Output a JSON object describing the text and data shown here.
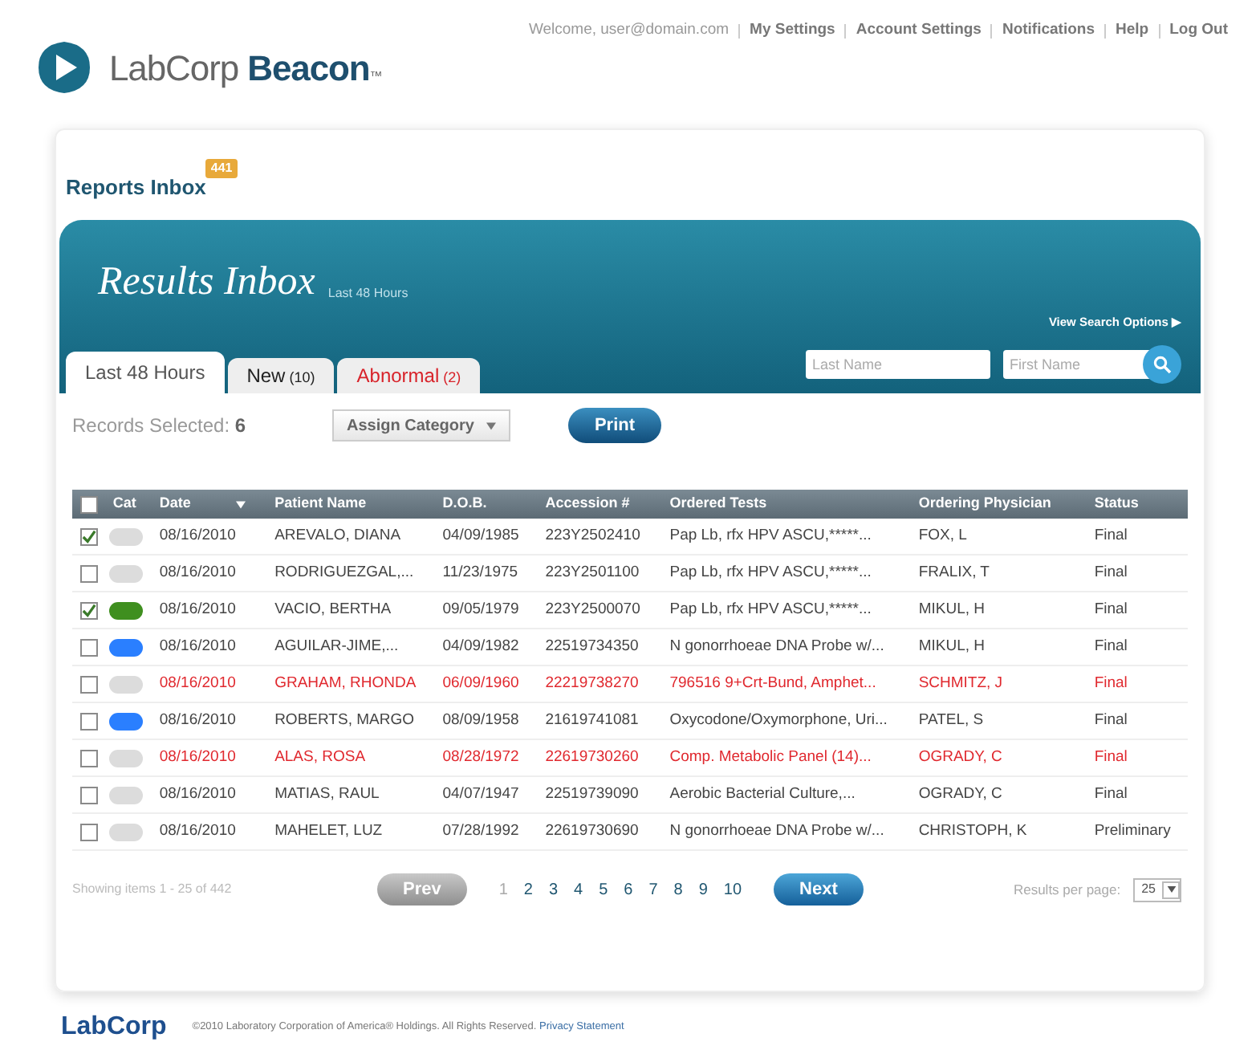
{
  "header": {
    "logo_text": "LabCorp",
    "logo_bold": "Beacon",
    "logo_mark": "™",
    "welcome": "Welcome, user@domain.com",
    "nav": [
      "My Settings",
      "Account Settings",
      "Notifications",
      "Help",
      "Log Out"
    ]
  },
  "reports_inbox": {
    "title": "Reports Inbox",
    "badge": "441"
  },
  "banner": {
    "title": "Results Inbox",
    "subtitle": "Last 48 Hours",
    "search_options": "View Search Options ▶"
  },
  "tabs": [
    {
      "label": "Last 48 Hours",
      "kind": "plain",
      "selected": true
    },
    {
      "label": "New",
      "count": "(10)",
      "kind": "plain",
      "selected": false
    },
    {
      "label": "Abnormal",
      "count": "(2)",
      "kind": "alert",
      "selected": false
    }
  ],
  "search": {
    "last_name": {
      "placeholder": "Last Name"
    },
    "first_name": {
      "placeholder": "First Name"
    }
  },
  "toolbar": {
    "records_label": "Records Selected:",
    "records_count": "6",
    "assign": "Assign Category",
    "print": "Print"
  },
  "table": {
    "select_all_checked": false,
    "category_header": "Cat",
    "columns": [
      "Date",
      "Patient Name",
      "D.O.B.",
      "Accession #",
      "Ordered Tests",
      "Ordering Physician",
      "Status"
    ],
    "rows": [
      {
        "checked": true,
        "color": "#dcdcdc",
        "abnormal": false,
        "cells": [
          "08/16/2010",
          "AREVALO, DIANA",
          "04/09/1985",
          "223Y2502410",
          "Pap Lb, rfx HPV ASCU,*****...",
          "FOX, L",
          "Final"
        ]
      },
      {
        "checked": false,
        "color": "#dcdcdc",
        "abnormal": false,
        "cells": [
          "08/16/2010",
          "RODRIGUEZGAL,...",
          "11/23/1975",
          "223Y2501100",
          "Pap Lb, rfx HPV ASCU,*****...",
          "FRALIX, T",
          "Final"
        ]
      },
      {
        "checked": true,
        "color": "#3f8f1f",
        "abnormal": false,
        "cells": [
          "08/16/2010",
          "VACIO, BERTHA",
          "09/05/1979",
          "223Y2500070",
          "Pap Lb, rfx HPV ASCU,*****...",
          "MIKUL, H",
          "Final"
        ]
      },
      {
        "checked": false,
        "color": "#2a7fff",
        "abnormal": false,
        "cells": [
          "08/16/2010",
          "AGUILAR-JIME,...",
          "04/09/1982",
          "22519734350",
          "N gonorrhoeae DNA Probe w/...",
          "MIKUL, H",
          "Final"
        ]
      },
      {
        "checked": false,
        "color": "#dcdcdc",
        "abnormal": true,
        "cells": [
          "08/16/2010",
          "GRAHAM, RHONDA",
          "06/09/1960",
          "22219738270",
          "796516 9+Crt-Bund, Amphet...",
          "SCHMITZ, J",
          "Final"
        ]
      },
      {
        "checked": false,
        "color": "#2a7fff",
        "abnormal": false,
        "cells": [
          "08/16/2010",
          "ROBERTS, MARGO",
          "08/09/1958",
          "21619741081",
          "Oxycodone/Oxymorphone, Uri...",
          "PATEL, S",
          "Final"
        ]
      },
      {
        "checked": false,
        "color": "#dcdcdc",
        "abnormal": true,
        "cells": [
          "08/16/2010",
          "ALAS, ROSA",
          "08/28/1972",
          "22619730260",
          "Comp. Metabolic Panel (14)...",
          "OGRADY, C",
          "Final"
        ]
      },
      {
        "checked": false,
        "color": "#dcdcdc",
        "abnormal": false,
        "cells": [
          "08/16/2010",
          "MATIAS, RAUL",
          "04/07/1947",
          "22519739090",
          "Aerobic Bacterial Culture,...",
          "OGRADY, C",
          "Final"
        ]
      },
      {
        "checked": false,
        "color": "#dcdcdc",
        "abnormal": false,
        "cells": [
          "08/16/2010",
          "MAHELET, LUZ",
          "07/28/1992",
          "22619730690",
          "N gonorrhoeae DNA Probe w/...",
          "CHRISTOPH, K",
          "Preliminary"
        ]
      }
    ]
  },
  "pagination": {
    "showing": "Showing items 1 - 25 of 442",
    "prev": "Prev",
    "next": "Next",
    "pages": [
      {
        "label": "1",
        "selected": true
      },
      {
        "label": "2",
        "selected": false
      },
      {
        "label": "3",
        "selected": false
      },
      {
        "label": "4",
        "selected": false
      },
      {
        "label": "5",
        "selected": false
      },
      {
        "label": "6",
        "selected": false
      },
      {
        "label": "7",
        "selected": false
      },
      {
        "label": "8",
        "selected": false
      },
      {
        "label": "9",
        "selected": false
      },
      {
        "label": "10",
        "selected": false
      }
    ],
    "per_page_label": "Results per page:",
    "per_page": "25"
  },
  "footer": {
    "logo": "LabCorp",
    "copyright": "©2010 Laboratory Corporation of America® Holdings. All Rights Reserved.",
    "privacy": "Privacy Statement"
  }
}
